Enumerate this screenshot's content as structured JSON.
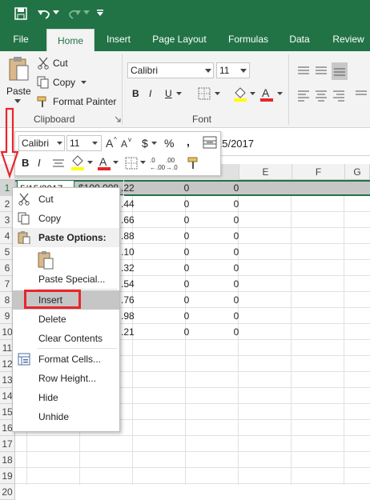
{
  "titlebar": {
    "save_icon": "save-icon",
    "undo_icon": "undo-icon",
    "redo_icon": "redo-icon",
    "qat_icon": "qat-dropdown-icon"
  },
  "tabs": [
    "File",
    "Home",
    "Insert",
    "Page Layout",
    "Formulas",
    "Data",
    "Review"
  ],
  "ribbon": {
    "paste_label": "Paste",
    "cut_label": "Cut",
    "copy_label": "Copy",
    "format_painter_label": "Format Painter",
    "clipboard_group": "Clipboard",
    "font_name": "Calibri",
    "font_size": "11",
    "font_group": "Font",
    "bold": "B",
    "italic": "I",
    "underline": "U"
  },
  "formula_bar": {
    "visible_value": "15/2017"
  },
  "mini_toolbar": {
    "font_name": "Calibri",
    "font_size": "11",
    "currency": "$",
    "percent": "%",
    "comma": ","
  },
  "columns": [
    "E",
    "F",
    "G"
  ],
  "rows": [
    "1",
    "2",
    "3",
    "4",
    "5",
    "6",
    "7",
    "8",
    "9",
    "10",
    "11",
    "12",
    "13",
    "14",
    "15",
    "16",
    "17",
    "18",
    "19",
    "20"
  ],
  "row1": {
    "date": "5/15/2017",
    "amount": "$100,008",
    "b_frag": ".22",
    "c": "0",
    "d": "0"
  },
  "b_values": [
    ".44",
    ".66",
    ".88",
    ".10",
    ".32",
    ".54",
    ".76",
    ".98",
    ".21"
  ],
  "c_values": [
    "0",
    "0",
    "0",
    "0",
    "0",
    "0",
    "0",
    "0",
    "0"
  ],
  "d_values": [
    "0",
    "0",
    "0",
    "0",
    "0",
    "0",
    "0",
    "0",
    "0"
  ],
  "context_menu": {
    "cut": "Cut",
    "copy": "Copy",
    "paste_options": "Paste Options:",
    "paste_special": "Paste Special...",
    "insert": "Insert",
    "delete": "Delete",
    "clear_contents": "Clear Contents",
    "format_cells": "Format Cells...",
    "row_height": "Row Height...",
    "hide": "Hide",
    "unhide": "Unhide"
  },
  "colors": {
    "excel_green": "#217346",
    "highlight_red": "#e8262a",
    "selection_gray": "#c6c6c6"
  }
}
